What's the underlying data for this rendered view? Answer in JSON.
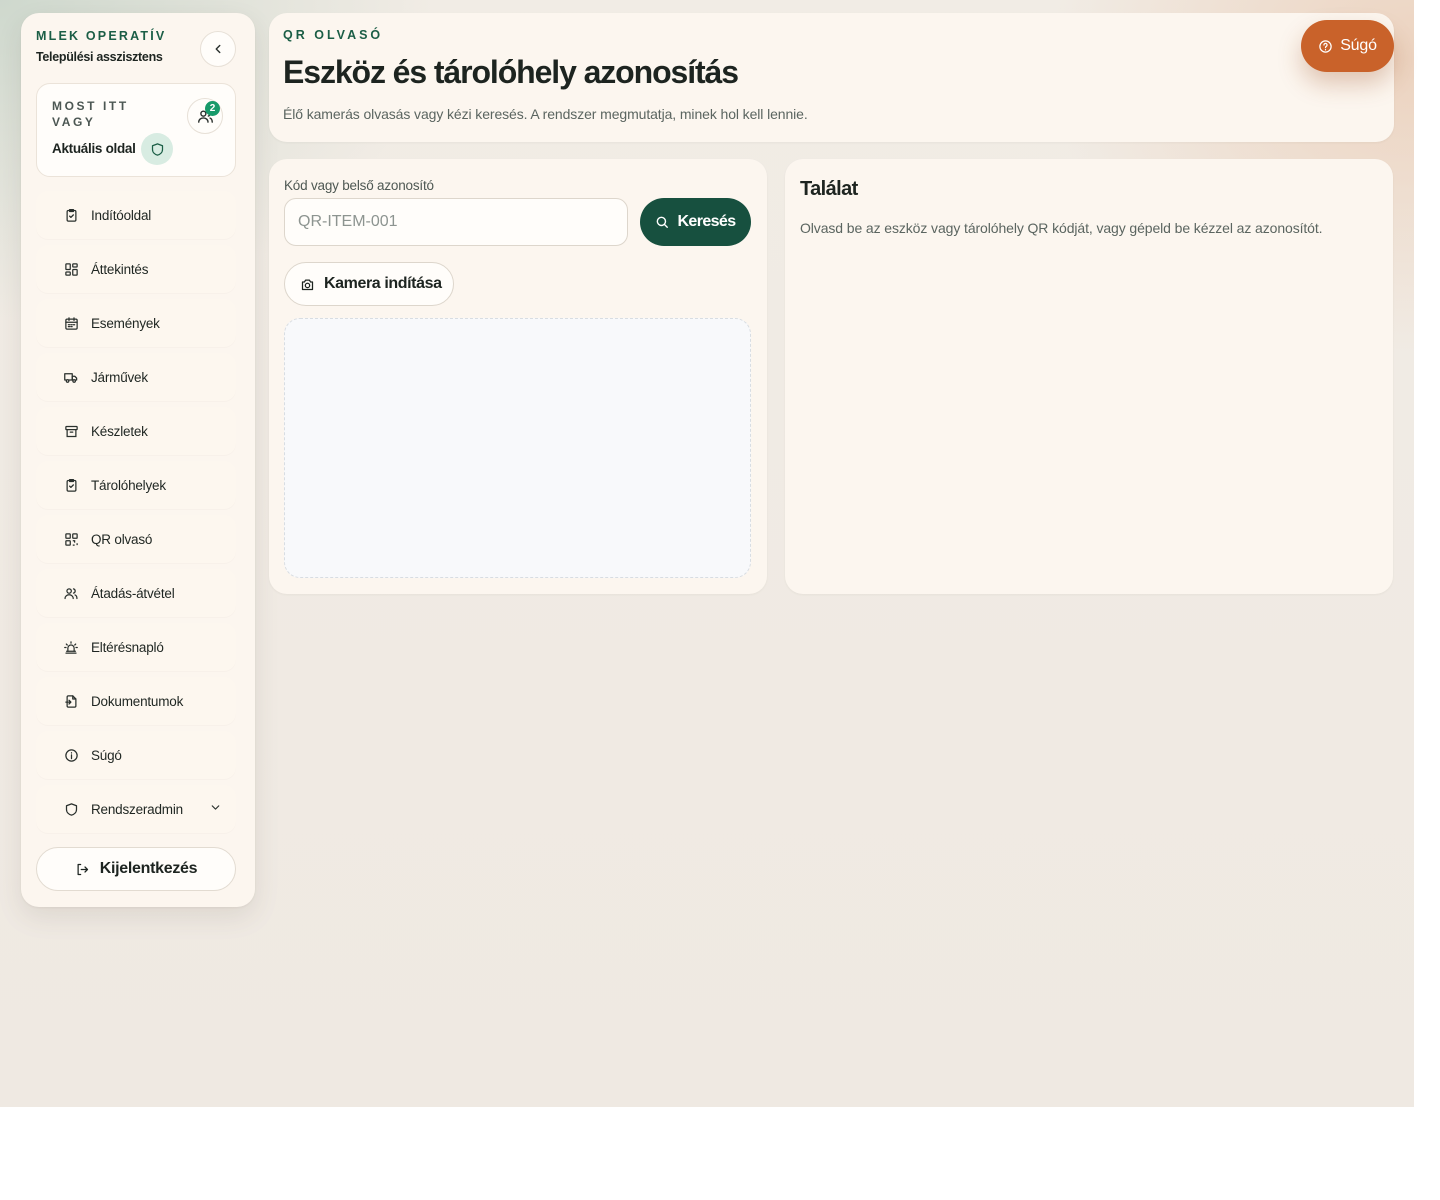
{
  "sidebar": {
    "brand_kicker": "MLEK OPERATÍV",
    "brand_subtitle": "Települési asszisztens",
    "collapse_icon": "chevron-left-icon",
    "here_card": {
      "kicker": "MOST ITT VAGY",
      "label": "Aktuális oldal",
      "icon": "shield-icon",
      "users_icon": "users-icon",
      "users_count": "2"
    },
    "items": [
      {
        "label": "Indítóoldal",
        "icon": "clipboard-check-icon"
      },
      {
        "label": "Áttekintés",
        "icon": "grid-icon"
      },
      {
        "label": "Események",
        "icon": "calendar-icon"
      },
      {
        "label": "Járművek",
        "icon": "truck-icon"
      },
      {
        "label": "Készletek",
        "icon": "archive-icon"
      },
      {
        "label": "Tárolóhelyek",
        "icon": "clipboard-check-icon"
      },
      {
        "label": "QR olvasó",
        "icon": "qr-code-icon"
      },
      {
        "label": "Átadás-átvétel",
        "icon": "users-icon"
      },
      {
        "label": "Eltérésnapló",
        "icon": "alarm-icon"
      },
      {
        "label": "Dokumentumok",
        "icon": "file-export-icon"
      },
      {
        "label": "Súgó",
        "icon": "info-icon"
      },
      {
        "label": "Rendszeradmin",
        "icon": "shield-icon",
        "expandable": true
      }
    ],
    "logout_label": "Kijelentkezés"
  },
  "header": {
    "kicker": "QR OLVASÓ",
    "title": "Eszköz és tárolóhely azonosítás",
    "description": "Élő kamerás olvasás vagy kézi keresés. A rendszer megmutatja, minek hol kell lennie."
  },
  "help_button": {
    "label": "Súgó",
    "icon": "help-circle-icon"
  },
  "scanner": {
    "field_label": "Kód vagy belső azonosító",
    "input_value": "",
    "input_placeholder": "QR-ITEM-001",
    "search_label": "Keresés",
    "camera_label": "Kamera indítása"
  },
  "result": {
    "title": "Találat",
    "description": "Olvasd be az eszköz vagy tárolóhely QR kódját, vagy gépeld be kézzel az azonosítót."
  },
  "colors": {
    "accent_green": "#17503f",
    "kicker_green": "#1b5e46",
    "badge_green": "#179a6a",
    "help_orange": "#c9622a",
    "card_bg": "#fcf6ef"
  }
}
